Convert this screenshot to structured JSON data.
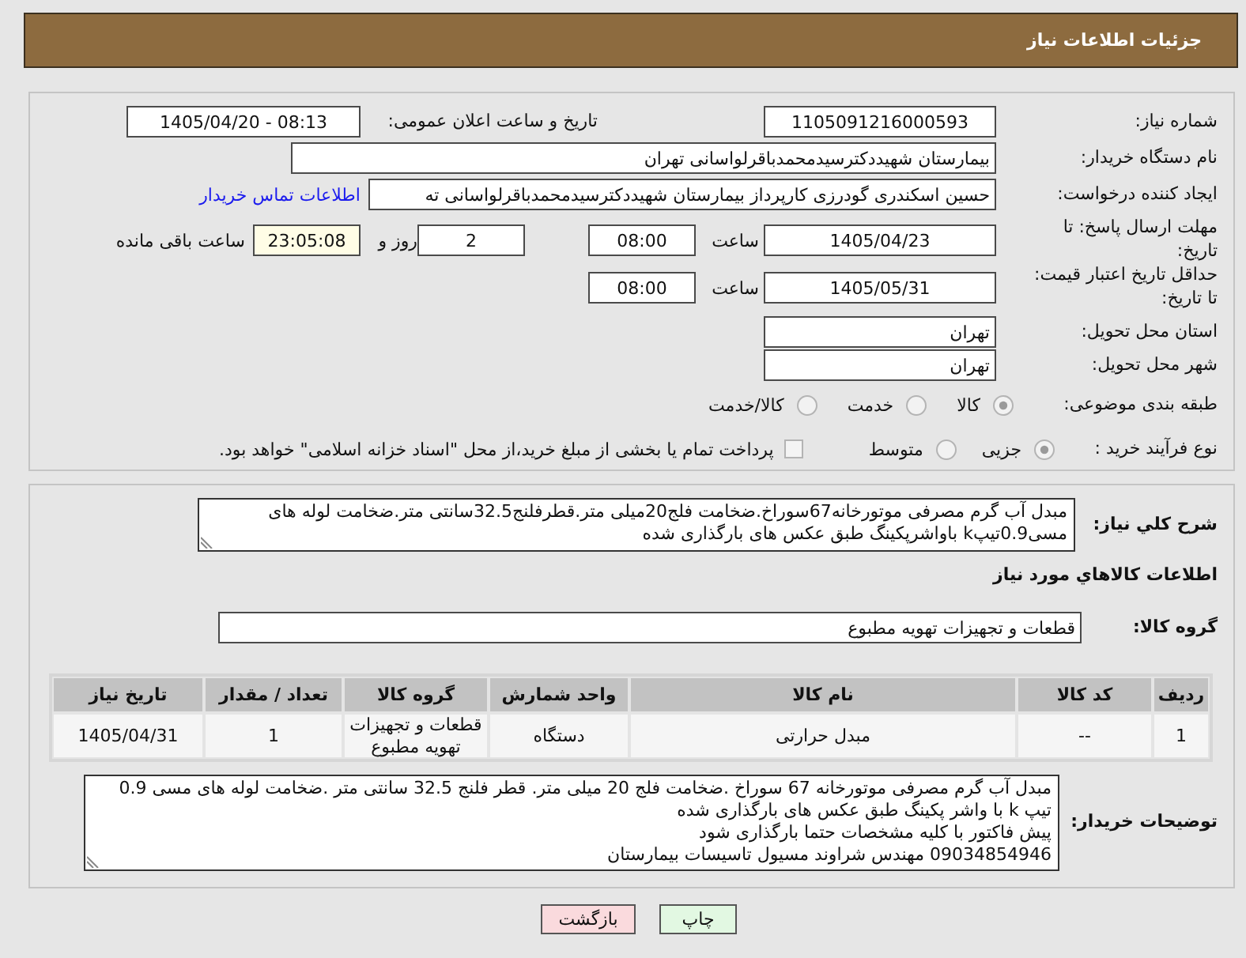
{
  "header": {
    "title": "جزئیات اطلاعات نیاز"
  },
  "need": {
    "number": {
      "label": "شماره نیاز:",
      "value": "1105091216000593"
    },
    "announced": {
      "label": "تاریخ و ساعت اعلان عمومی:",
      "value": "1405/04/20 - 08:13"
    },
    "buyer": {
      "label": "نام دستگاه خریدار:",
      "value": "بیمارستان شهیددکترسیدمحمدباقرلواسانی تهران"
    },
    "requester": {
      "label": "ایجاد کننده درخواست:",
      "value": "حسین اسکندری گودرزی کارپرداز بیمارستان شهیددکترسیدمحمدباقرلواسانی ته",
      "contact_link": "اطلاعات تماس خریدار"
    },
    "response_deadline": {
      "label": "مهلت ارسال پاسخ: تا تاریخ:",
      "date": "1405/04/23",
      "time_label": "ساعت",
      "time": "08:00",
      "days": "2",
      "days_label": "روز و",
      "remaining": "23:05:08",
      "remaining_label": "ساعت باقی مانده"
    },
    "price_validity": {
      "label": "حداقل تاریخ اعتبار قیمت: تا تاریخ:",
      "date": "1405/05/31",
      "time_label": "ساعت",
      "time": "08:00"
    },
    "province": {
      "label": "استان محل تحویل:",
      "value": "تهران"
    },
    "city": {
      "label": "شهر محل تحویل:",
      "value": "تهران"
    },
    "category": {
      "label": "طبقه بندی موضوعی:",
      "options": [
        {
          "label": "کالا",
          "selected": true
        },
        {
          "label": "خدمت",
          "selected": false
        },
        {
          "label": "کالا/خدمت",
          "selected": false
        }
      ]
    },
    "purchase_process": {
      "label": "نوع فرآیند خرید :",
      "options": [
        {
          "label": "جزیی",
          "selected": true
        },
        {
          "label": "متوسط",
          "selected": false
        }
      ],
      "treasury": {
        "label": "پرداخت تمام یا بخشی از مبلغ خرید،از محل \"اسناد خزانه اسلامی\" خواهد بود.",
        "checked": false
      }
    }
  },
  "goods": {
    "summary": {
      "label": "شرح کلي نیاز:",
      "value": "مبدل آب گرم مصرفی موتورخانه67سوراخ.ضخامت فلج20میلی متر.قطرفلنج32.5سانتی متر.ضخامت لوله های مسی0.9تیپk باواشرپکینگ طبق عکس های بارگذاری شده"
    },
    "section_title": "اطلاعات کالاهاي مورد نیاز",
    "group": {
      "label": "گروه کالا:",
      "value": "قطعات و تجهیزات تهویه مطبوع"
    },
    "table": {
      "columns": [
        "ردیف",
        "کد کالا",
        "نام کالا",
        "واحد شمارش",
        "گروه کالا",
        "تعداد / مقدار",
        "تاریخ نیاز"
      ],
      "rows": [
        [
          "1",
          "--",
          "مبدل حرارتی",
          "دستگاه",
          "قطعات و تجهیزات تهویه مطبوع",
          "1",
          "1405/04/31"
        ]
      ]
    },
    "buyer_notes": {
      "label": "توضیحات خریدار:",
      "value": "مبدل آب گرم مصرفی موتورخانه 67 سوراخ .ضخامت فلج 20 میلی متر. قطر فلنج 32.5 سانتی متر .ضخامت لوله های مسی 0.9 تیپ k با واشر پکینگ طبق عکس های بارگذاری شده\nپیش فاکتور با کلیه مشخصات حتما بارگذاری شود\n09034854946 مهندس شراوند مسیول تاسیسات بیمارستان"
    }
  },
  "buttons": [
    {
      "kind": "print",
      "label": "چاپ"
    },
    {
      "kind": "back",
      "label": "بازگشت"
    }
  ]
}
